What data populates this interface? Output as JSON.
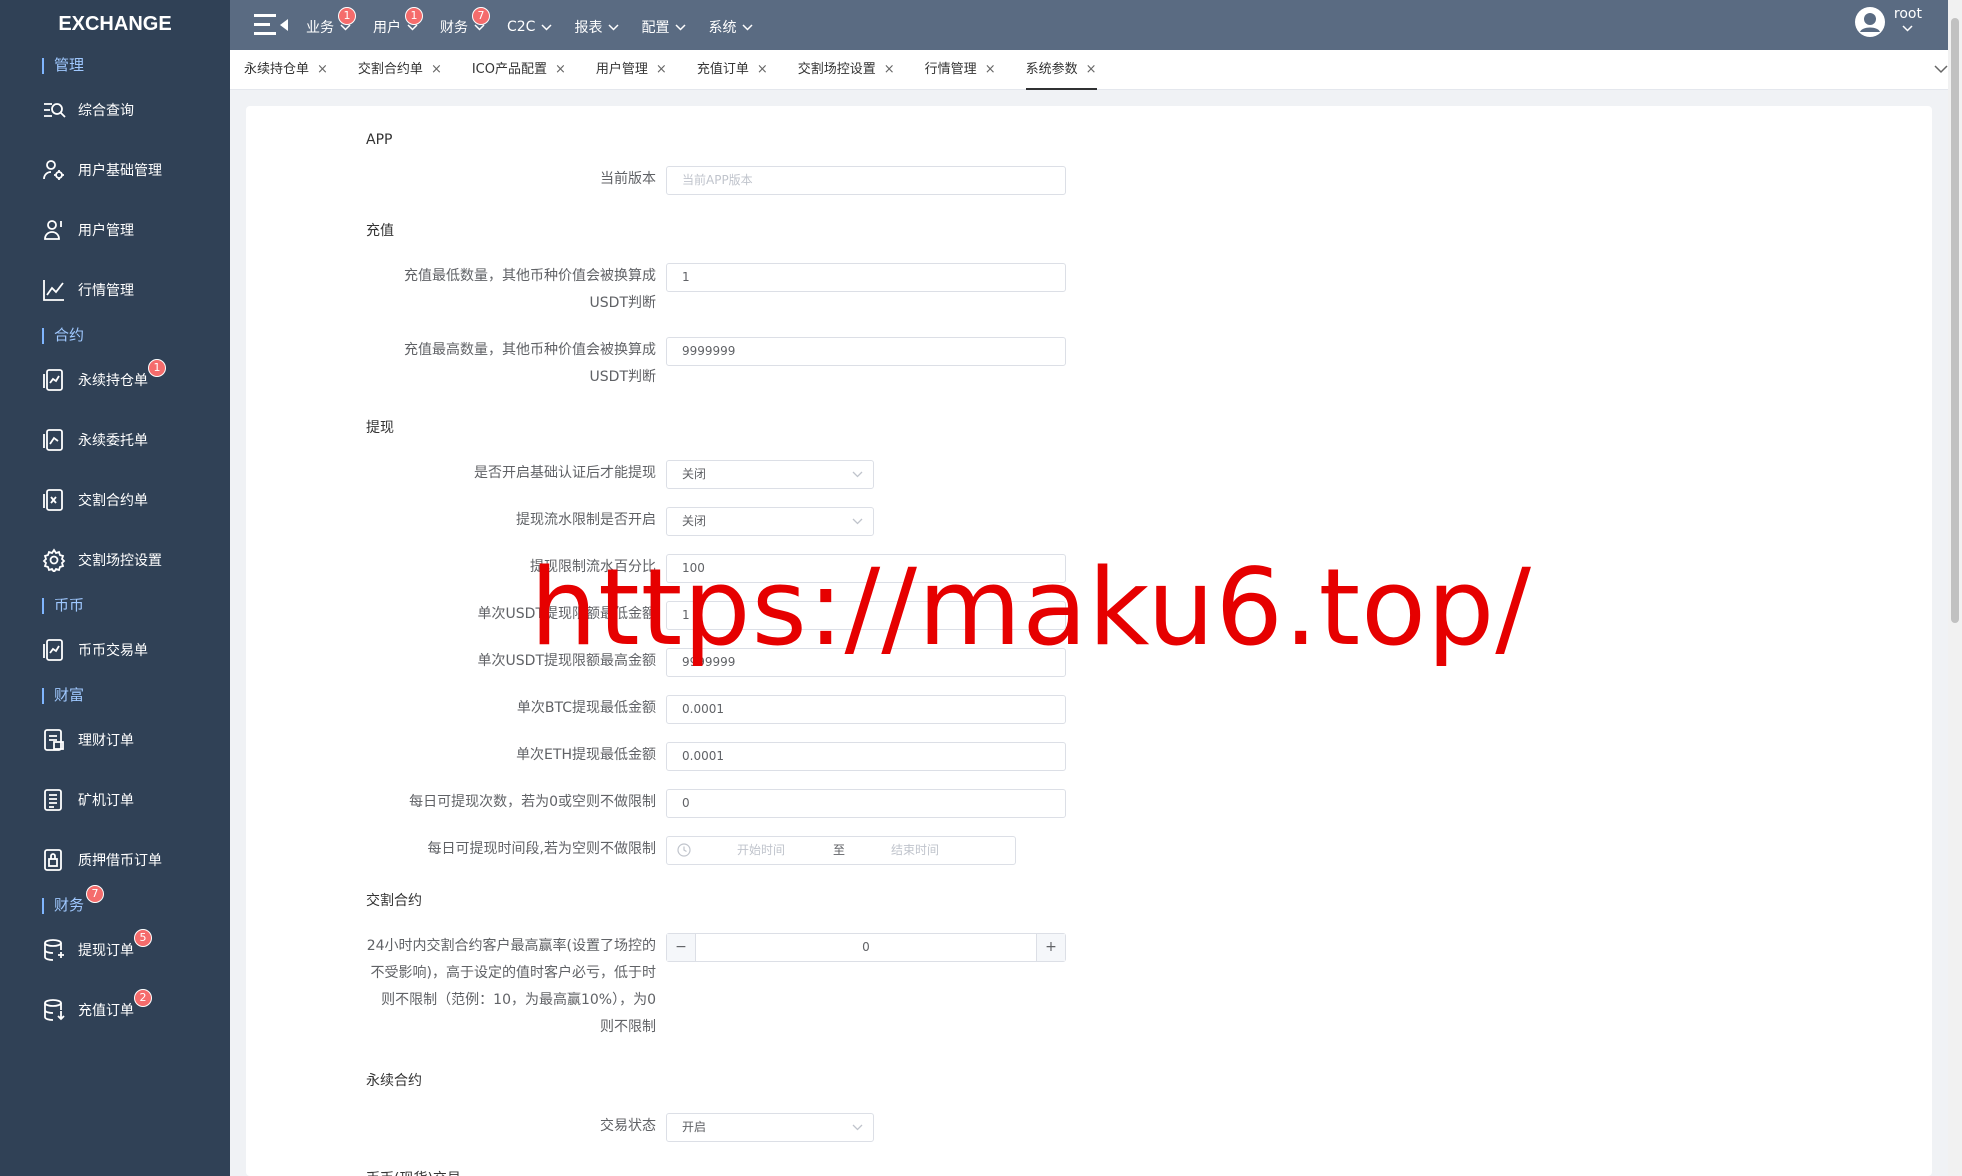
{
  "app": {
    "logo": "EXCHANGE"
  },
  "sidebar": {
    "sections": [
      {
        "label": "管理",
        "items": [
          {
            "label": "综合查询",
            "icon": "search-list-icon"
          },
          {
            "label": "用户基础管理",
            "icon": "user-gear-icon"
          },
          {
            "label": "用户管理",
            "icon": "user-icon"
          },
          {
            "label": "行情管理",
            "icon": "chart-line-icon"
          }
        ]
      },
      {
        "label": "合约",
        "items": [
          {
            "label": "永续持仓单",
            "icon": "doc-chart-icon",
            "badge": "1"
          },
          {
            "label": "永续委托单",
            "icon": "doc-chart-icon"
          },
          {
            "label": "交割合约单",
            "icon": "doc-chart-icon"
          },
          {
            "label": "交割场控设置",
            "icon": "gear-icon"
          }
        ]
      },
      {
        "label": "币币",
        "items": [
          {
            "label": "币币交易单",
            "icon": "doc-chart-icon"
          }
        ]
      },
      {
        "label": "财富",
        "items": [
          {
            "label": "理财订单",
            "icon": "doc-icon"
          },
          {
            "label": "矿机订单",
            "icon": "list-icon"
          },
          {
            "label": "质押借币订单",
            "icon": "doc-lock-icon"
          }
        ]
      },
      {
        "label": "财务",
        "badge": "7",
        "items": [
          {
            "label": "提现订单",
            "icon": "database-icon",
            "badge": "5"
          },
          {
            "label": "充值订单",
            "icon": "database-icon",
            "badge": "2"
          }
        ]
      }
    ]
  },
  "topbar": {
    "menus": [
      {
        "label": "业务",
        "badge": "1"
      },
      {
        "label": "用户",
        "badge": "1"
      },
      {
        "label": "财务",
        "badge": "7"
      },
      {
        "label": "C2C"
      },
      {
        "label": "报表"
      },
      {
        "label": "配置"
      },
      {
        "label": "系统"
      }
    ],
    "user": "root"
  },
  "tabs": [
    {
      "label": "永续持仓单"
    },
    {
      "label": "交割合约单"
    },
    {
      "label": "ICO产品配置"
    },
    {
      "label": "用户管理"
    },
    {
      "label": "充值订单"
    },
    {
      "label": "交割场控设置"
    },
    {
      "label": "行情管理"
    },
    {
      "label": "系统参数",
      "active": true
    }
  ],
  "form": {
    "app": {
      "title": "APP",
      "version_label": "当前版本",
      "version_placeholder": "当前APP版本"
    },
    "recharge": {
      "title": "充值",
      "min_label_1": "充值最低数量，其他币种价值会被换算成",
      "min_label_2": "USDT判断",
      "min_value": "1",
      "max_label_1": "充值最高数量，其他币种价值会被换算成",
      "max_label_2": "USDT判断",
      "max_value": "9999999"
    },
    "withdraw": {
      "title": "提现",
      "basic_auth_label": "是否开启基础认证后才能提现",
      "basic_auth_value": "关闭",
      "flow_limit_label": "提现流水限制是否开启",
      "flow_limit_value": "关闭",
      "flow_pct_label": "提现限制流水百分比",
      "flow_pct_value": "100",
      "usdt_min_label": "单次USDT提现限额最低金额",
      "usdt_min_value": "1",
      "usdt_max_label": "单次USDT提现限额最高金额",
      "usdt_max_value": "9999999",
      "btc_min_label": "单次BTC提现最低金额",
      "btc_min_value": "0.0001",
      "eth_min_label": "单次ETH提现最低金额",
      "eth_min_value": "0.0001",
      "daily_count_label": "每日可提现次数，若为0或空则不做限制",
      "daily_count_value": "0",
      "time_label": "每日可提现时间段,若为空则不做限制",
      "time_start": "开始时间",
      "time_sep": "至",
      "time_end": "结束时间"
    },
    "delivery": {
      "title": "交割合约",
      "winrate_l1": "24小时内交割合约客户最高赢率(设置了场控的",
      "winrate_l2": "不受影响)，高于设定的值时客户必亏，低于时",
      "winrate_l3": "则不限制（范例：10，为最高赢10%），为0",
      "winrate_l4": "则不限制",
      "winrate_value": "0",
      "minus": "−",
      "plus": "+"
    },
    "perpetual": {
      "title": "永续合约",
      "status_label": "交易状态",
      "status_value": "开启"
    },
    "spot": {
      "title": "币币(现货)交易"
    }
  },
  "watermark": "https://maku6.top/"
}
